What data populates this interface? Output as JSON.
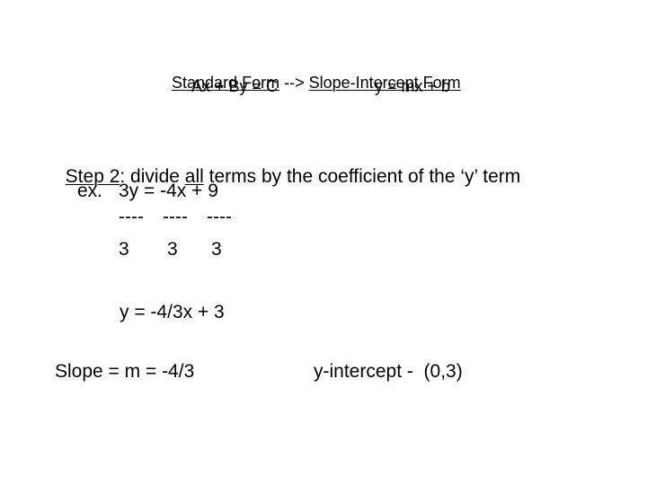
{
  "slide": {
    "header": {
      "left_title": "Standard Form",
      "arrow": " --> ",
      "right_title": "Slope-Intercept Form",
      "left_formula": "Ax + By = C",
      "right_formula": "y = mx + b"
    },
    "step": {
      "label": "Step 2",
      "text_before": ": divide ",
      "emphasis": "all",
      "text_after": " terms by the coefficient of the ‘y’ term"
    },
    "example": {
      "prefix": "ex.",
      "equation": "3y = -4x + 9",
      "division_bars": [
        "----",
        "----",
        "----"
      ],
      "divisors": [
        "3",
        "3",
        "3"
      ],
      "result": "y = -4/3x + 3"
    },
    "summary": {
      "slope": "Slope = m = -4/3",
      "intercept": "y-intercept -  (0,3)"
    }
  }
}
